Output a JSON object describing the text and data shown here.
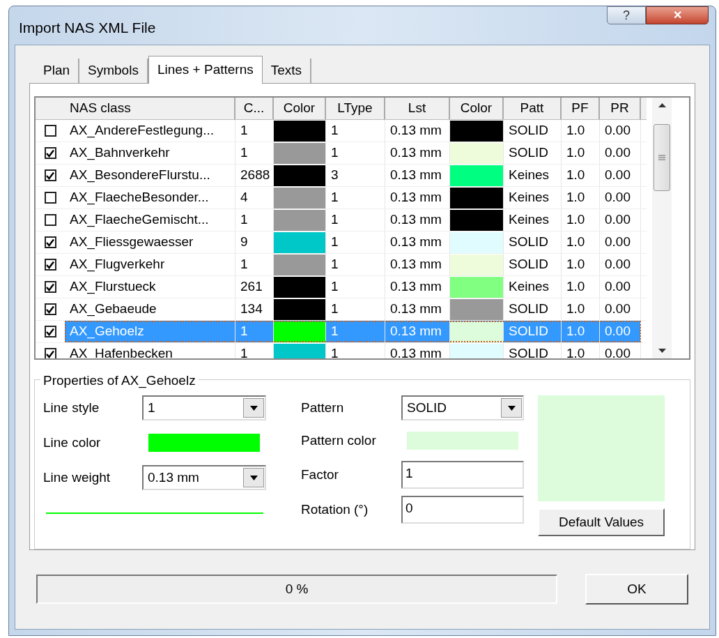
{
  "window": {
    "title": "Import NAS XML File",
    "help": "?",
    "close": "✕"
  },
  "tabs": [
    {
      "label": "Plan",
      "selected": false
    },
    {
      "label": "Symbols",
      "selected": false
    },
    {
      "label": "Lines + Patterns",
      "selected": true
    },
    {
      "label": "Texts",
      "selected": false
    }
  ],
  "table": {
    "columns": [
      "NAS class",
      "C...",
      "Color",
      "LType",
      "Lst",
      "Color",
      "Patt",
      "PF",
      "PR"
    ],
    "rows": [
      {
        "checked": false,
        "name": "AX_AndereFestlegung...",
        "count": "1",
        "swatches": [
          {
            "color": "#000000"
          },
          {
            "color": "#000000"
          }
        ],
        "ltype": "1",
        "lst": "0.13 mm",
        "patt": "SOLID",
        "pf": "1.0",
        "pr": "0.00",
        "selected": false
      },
      {
        "checked": true,
        "name": "AX_Bahnverkehr",
        "count": "1",
        "swatches": [
          {
            "color": "#999999"
          },
          {
            "color": "#eefcdc"
          }
        ],
        "ltype": "1",
        "lst": "0.13 mm",
        "patt": "SOLID",
        "pf": "1.0",
        "pr": "0.00",
        "selected": false
      },
      {
        "checked": true,
        "name": "AX_BesondereFlurstu...",
        "count": "2688",
        "swatches": [
          {
            "color": "#000000"
          },
          {
            "color": "#00ff80"
          }
        ],
        "ltype": "3",
        "lst": "0.13 mm",
        "patt": "Keines",
        "pf": "1.0",
        "pr": "0.00",
        "selected": false
      },
      {
        "checked": false,
        "name": "AX_FlaecheBesonder...",
        "count": "4",
        "swatches": [
          {
            "color": "#999999"
          },
          {
            "color": "#000000"
          }
        ],
        "ltype": "1",
        "lst": "0.13 mm",
        "patt": "Keines",
        "pf": "1.0",
        "pr": "0.00",
        "selected": false
      },
      {
        "checked": false,
        "name": "AX_FlaecheGemischt...",
        "count": "1",
        "swatches": [
          {
            "color": "#999999"
          },
          {
            "color": "#000000"
          }
        ],
        "ltype": "1",
        "lst": "0.13 mm",
        "patt": "Keines",
        "pf": "1.0",
        "pr": "0.00",
        "selected": false
      },
      {
        "checked": true,
        "name": "AX_Fliessgewaesser",
        "count": "9",
        "swatches": [
          {
            "color": "#00c8c8"
          },
          {
            "color": "#e0fcff"
          }
        ],
        "ltype": "1",
        "lst": "0.13 mm",
        "patt": "SOLID",
        "pf": "1.0",
        "pr": "0.00",
        "selected": false
      },
      {
        "checked": true,
        "name": "AX_Flugverkehr",
        "count": "1",
        "swatches": [
          {
            "color": "#999999"
          },
          {
            "color": "#eefcdc"
          }
        ],
        "ltype": "1",
        "lst": "0.13 mm",
        "patt": "SOLID",
        "pf": "1.0",
        "pr": "0.00",
        "selected": false
      },
      {
        "checked": true,
        "name": "AX_Flurstueck",
        "count": "261",
        "swatches": [
          {
            "color": "#000000"
          },
          {
            "color": "#80ff80"
          }
        ],
        "ltype": "1",
        "lst": "0.13 mm",
        "patt": "Keines",
        "pf": "1.0",
        "pr": "0.00",
        "selected": false
      },
      {
        "checked": true,
        "name": "AX_Gebaeude",
        "count": "134",
        "swatches": [
          {
            "color": "#000000"
          },
          {
            "color": "#999999"
          }
        ],
        "ltype": "1",
        "lst": "0.13 mm",
        "patt": "SOLID",
        "pf": "1.0",
        "pr": "0.00",
        "selected": false
      },
      {
        "checked": true,
        "name": "AX_Gehoelz",
        "count": "1",
        "swatches": [
          {
            "color": "#00ff00"
          },
          {
            "color": "#dcfcdc"
          }
        ],
        "ltype": "1",
        "lst": "0.13 mm",
        "patt": "SOLID",
        "pf": "1.0",
        "pr": "0.00",
        "selected": true
      },
      {
        "checked": true,
        "name": "AX_Hafenbecken",
        "count": "1",
        "swatches": [
          {
            "color": "#00c8c8"
          },
          {
            "color": "#e0fcff"
          }
        ],
        "ltype": "1",
        "lst": "0.13 mm",
        "patt": "SOLID",
        "pf": "1.0",
        "pr": "0.00",
        "selected": false
      }
    ]
  },
  "properties": {
    "title": "Properties of AX_Gehoelz",
    "line_style": {
      "label": "Line style",
      "value": "1"
    },
    "line_color": {
      "label": "Line color",
      "color": "#00ff00"
    },
    "line_weight": {
      "label": "Line weight",
      "value": "0.13 mm"
    },
    "pattern": {
      "label": "Pattern",
      "value": "SOLID"
    },
    "pattern_color": {
      "label": "Pattern color",
      "color": "#dcfcdc"
    },
    "factor": {
      "label": "Factor",
      "value": "1"
    },
    "rotation": {
      "label": "Rotation (°)",
      "value": "0"
    },
    "default_button": "Default Values"
  },
  "progress": {
    "text": "0 %",
    "level": 0
  },
  "ok_button": "OK"
}
